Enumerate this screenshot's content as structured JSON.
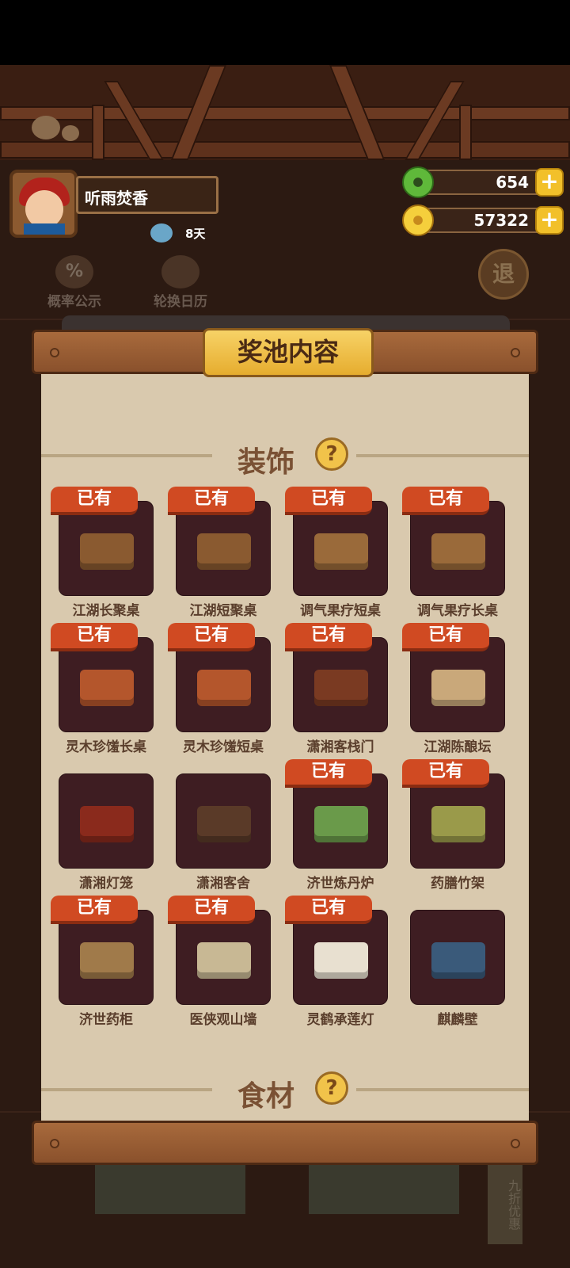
{
  "player": {
    "name": "听雨焚香",
    "days": "8天"
  },
  "currency": {
    "jade": {
      "value": "654",
      "plus": "+"
    },
    "coin": {
      "value": "57322",
      "plus": "+"
    }
  },
  "background_buttons": {
    "probability": {
      "label": "概率公示",
      "icon_text": "%"
    },
    "calendar": {
      "label": "轮换日历"
    },
    "exit": {
      "label": "退"
    },
    "bottom_side": "九折优惠"
  },
  "modal": {
    "title": "奖池内容",
    "sections": [
      {
        "title": "装饰",
        "help": "?"
      },
      {
        "title": "食材",
        "help": "?"
      }
    ],
    "owned_label": "已有",
    "items": [
      {
        "name": "江湖长聚桌",
        "owned": true,
        "icon": "tea-table-icon"
      },
      {
        "name": "江湖短聚桌",
        "owned": true,
        "icon": "tea-table-icon"
      },
      {
        "name": "调气果疗短桌",
        "owned": true,
        "icon": "fruit-table-icon"
      },
      {
        "name": "调气果疗长桌",
        "owned": true,
        "icon": "fruit-table-icon"
      },
      {
        "name": "灵木珍馐长桌",
        "owned": true,
        "icon": "feast-table-icon"
      },
      {
        "name": "灵木珍馐短桌",
        "owned": true,
        "icon": "feast-table-icon"
      },
      {
        "name": "潇湘客栈门",
        "owned": true,
        "icon": "inn-door-icon"
      },
      {
        "name": "江湖陈酿坛",
        "owned": true,
        "icon": "wine-jars-icon"
      },
      {
        "name": "潇湘灯笼",
        "owned": false,
        "icon": "lantern-icon"
      },
      {
        "name": "潇湘客舍",
        "owned": false,
        "icon": "guest-room-icon"
      },
      {
        "name": "济世炼丹炉",
        "owned": true,
        "icon": "alchemy-furnace-icon"
      },
      {
        "name": "药膳竹架",
        "owned": true,
        "icon": "bamboo-shelf-icon"
      },
      {
        "name": "济世药柜",
        "owned": true,
        "icon": "medicine-cabinet-icon"
      },
      {
        "name": "医侠观山墙",
        "owned": true,
        "icon": "mountain-wall-icon"
      },
      {
        "name": "灵鹤承莲灯",
        "owned": true,
        "icon": "crane-lamp-icon"
      },
      {
        "name": "麒麟壁",
        "owned": false,
        "icon": "qilin-wall-icon"
      }
    ]
  },
  "colors": {
    "badge": "#d04a22",
    "card": "#3e1d22",
    "scroll": "#d9c9ae",
    "title_plate": "#f1c34a"
  }
}
